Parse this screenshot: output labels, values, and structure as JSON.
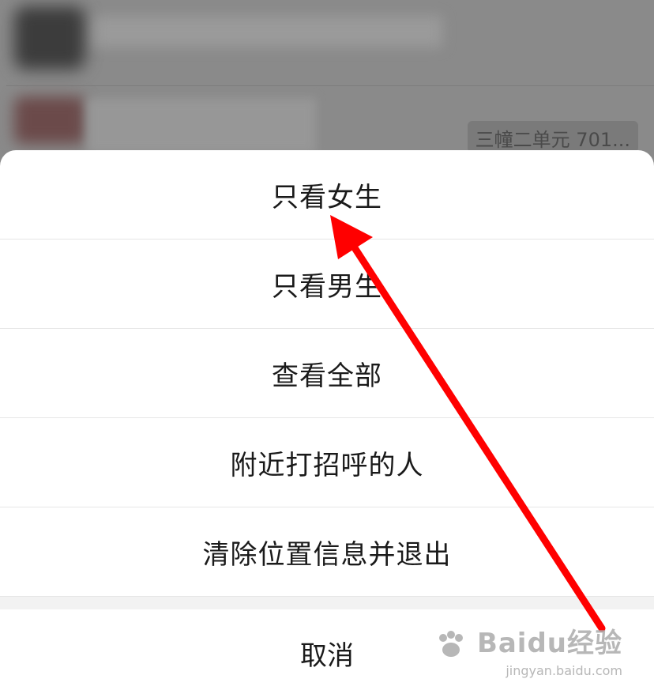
{
  "background": {
    "tag_text": "三幢二单元 701..."
  },
  "action_sheet": {
    "options": [
      {
        "label": "只看女生"
      },
      {
        "label": "只看男生"
      },
      {
        "label": "查看全部"
      },
      {
        "label": "附近打招呼的人"
      },
      {
        "label": "清除位置信息并退出"
      }
    ],
    "cancel_label": "取消"
  },
  "annotation": {
    "arrow_color": "#ff0000"
  },
  "watermark": {
    "logo_text": "Baidu经验",
    "url_text": "jingyan.baidu.com"
  }
}
